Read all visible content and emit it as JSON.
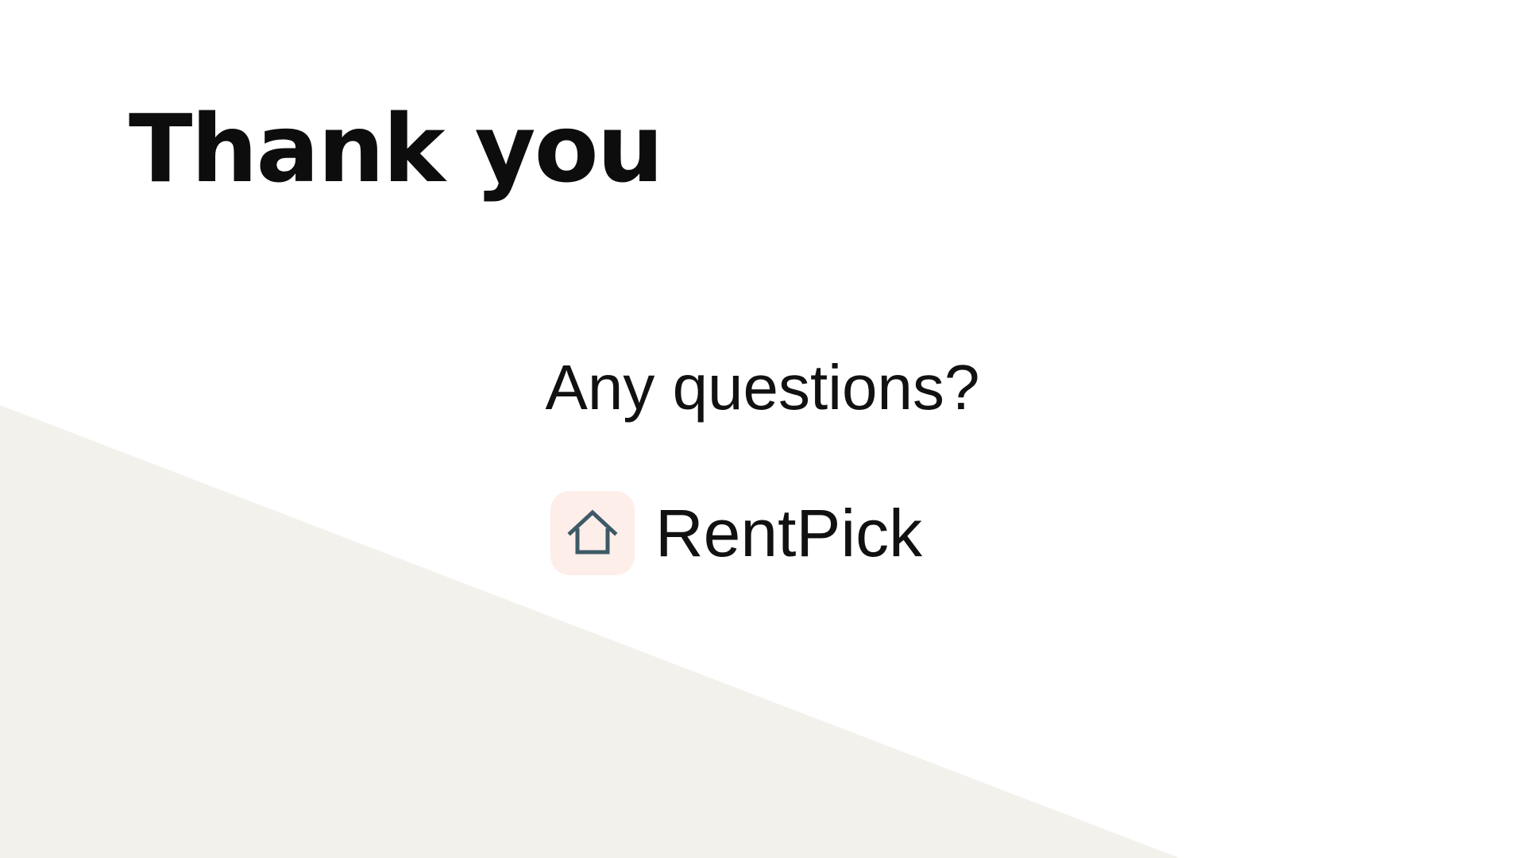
{
  "slide": {
    "title": "Thank you",
    "question": "Any questions?",
    "brand": {
      "name": "RentPick",
      "icon": "house-icon"
    }
  },
  "colors": {
    "background": "#ffffff",
    "accent_shape": "#f3f1ec",
    "icon_background": "#fdeeea",
    "icon_stroke": "#3d5a66",
    "text": "#111111"
  }
}
